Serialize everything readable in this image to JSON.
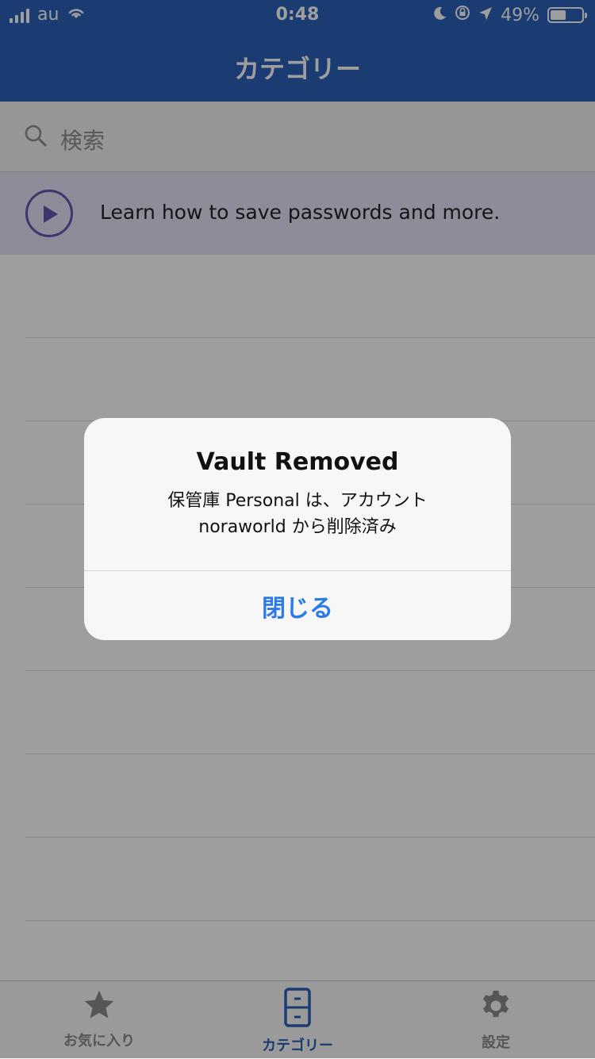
{
  "status_bar": {
    "carrier": "au",
    "time": "0:48",
    "battery": "49%"
  },
  "nav": {
    "title": "カテゴリー"
  },
  "search": {
    "placeholder": "検索"
  },
  "learn": {
    "text": "Learn how to save passwords and more."
  },
  "tabs": [
    {
      "label": "お気に入り"
    },
    {
      "label": "カテゴリー"
    },
    {
      "label": "設定"
    }
  ],
  "alert": {
    "title": "Vault Removed",
    "message_line1": "保管庫 Personal は、アカウント",
    "message_line2": "noraworld から削除済み",
    "button_label": "閉じる"
  },
  "colors": {
    "brand_blue": "#2d62b8",
    "accent_blue": "#2d7be9",
    "learn_purple": "#6a55b0"
  }
}
